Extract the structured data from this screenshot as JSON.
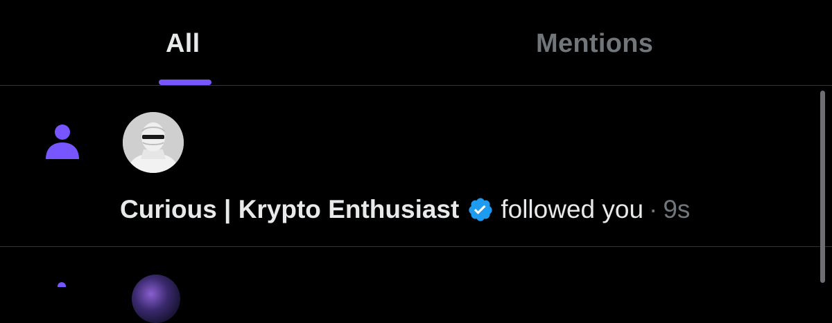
{
  "tabs": [
    {
      "label": "All",
      "selected": true
    },
    {
      "label": "Mentions",
      "selected": false
    }
  ],
  "colors": {
    "accent": "#7856ff",
    "verified": "#1d9bf0",
    "background": "#000000",
    "text_primary": "#e7e9ea",
    "text_secondary": "#71767b",
    "divider": "#2f3336"
  },
  "notifications": [
    {
      "type_icon": "person-icon",
      "avatar_icon": "user-avatar",
      "user_name": "Curious | Krypto Enthusiast",
      "verified_icon": "verified-badge-icon",
      "action": "followed you",
      "separator": "·",
      "time": "9s"
    }
  ]
}
